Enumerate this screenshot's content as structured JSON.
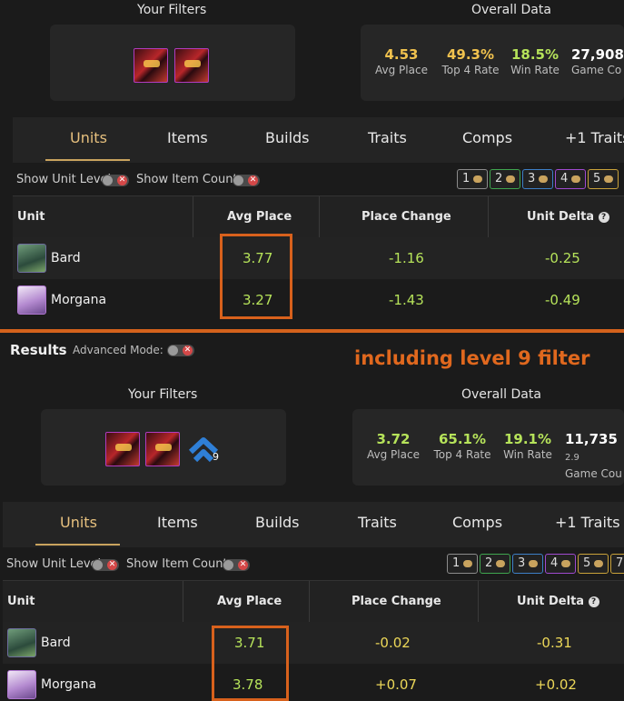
{
  "top": {
    "filters_title": "Your Filters",
    "overall_title": "Overall Data",
    "stats": [
      {
        "value": "4.53",
        "label": "Avg Place",
        "color": "#f1c24e"
      },
      {
        "value": "49.3%",
        "label": "Top 4 Rate",
        "color": "#f1c24e"
      },
      {
        "value": "18.5%",
        "label": "Win Rate",
        "color": "#b6e35a"
      },
      {
        "value": "27,908",
        "label": "Game Co",
        "color": "#ffffff"
      }
    ],
    "tabs": [
      "Units",
      "Items",
      "Builds",
      "Traits",
      "Comps",
      "+1 Traits"
    ],
    "toggles": [
      "Show Unit Level",
      "Show Item Count"
    ],
    "costs": [
      "1",
      "2",
      "3",
      "4",
      "5"
    ],
    "columns": [
      "Unit",
      "Avg Place",
      "Place Change",
      "Unit Delta"
    ],
    "rows": [
      {
        "unit": "Bard",
        "avg_place": "3.77",
        "place_change": "-1.16",
        "unit_delta": "-0.25"
      },
      {
        "unit": "Morgana",
        "avg_place": "3.27",
        "place_change": "-1.43",
        "unit_delta": "-0.49"
      }
    ]
  },
  "bottom": {
    "results_label": "Results",
    "advanced_mode_label": "Advanced Mode:",
    "annotation": "including level 9 filter",
    "filters_title": "Your Filters",
    "overall_title": "Overall Data",
    "level_badge": "9",
    "stats": [
      {
        "value": "3.72",
        "label": "Avg Place",
        "color": "#b6e35a"
      },
      {
        "value": "65.1%",
        "label": "Top 4 Rate",
        "color": "#b6e35a"
      },
      {
        "value": "19.1%",
        "label": "Win Rate",
        "color": "#b6e35a"
      },
      {
        "value": "11,735",
        "label": "Game Cou",
        "extra": "2.9",
        "color": "#ffffff"
      }
    ],
    "tabs": [
      "Units",
      "Items",
      "Builds",
      "Traits",
      "Comps",
      "+1 Traits"
    ],
    "toggles": [
      "Show Unit Level",
      "Show Item Count"
    ],
    "costs": [
      "1",
      "2",
      "3",
      "4",
      "5",
      "7"
    ],
    "columns": [
      "Unit",
      "Avg Place",
      "Place Change",
      "Unit Delta"
    ],
    "rows": [
      {
        "unit": "Bard",
        "avg_place": "3.71",
        "place_change": "-0.02",
        "unit_delta": "-0.31"
      },
      {
        "unit": "Morgana",
        "avg_place": "3.78",
        "place_change": "+0.07",
        "unit_delta": "+0.02"
      }
    ]
  },
  "icons": {
    "coin": "gold-coin-icon",
    "help": "help-circle-icon",
    "level": "level-chevron-icon",
    "toggle_off": "close-icon"
  },
  "colors": {
    "accent": "#d8611c",
    "tab_active": "#e6c07e",
    "positive": "#b6e35a",
    "neutral": "#ecd758"
  }
}
